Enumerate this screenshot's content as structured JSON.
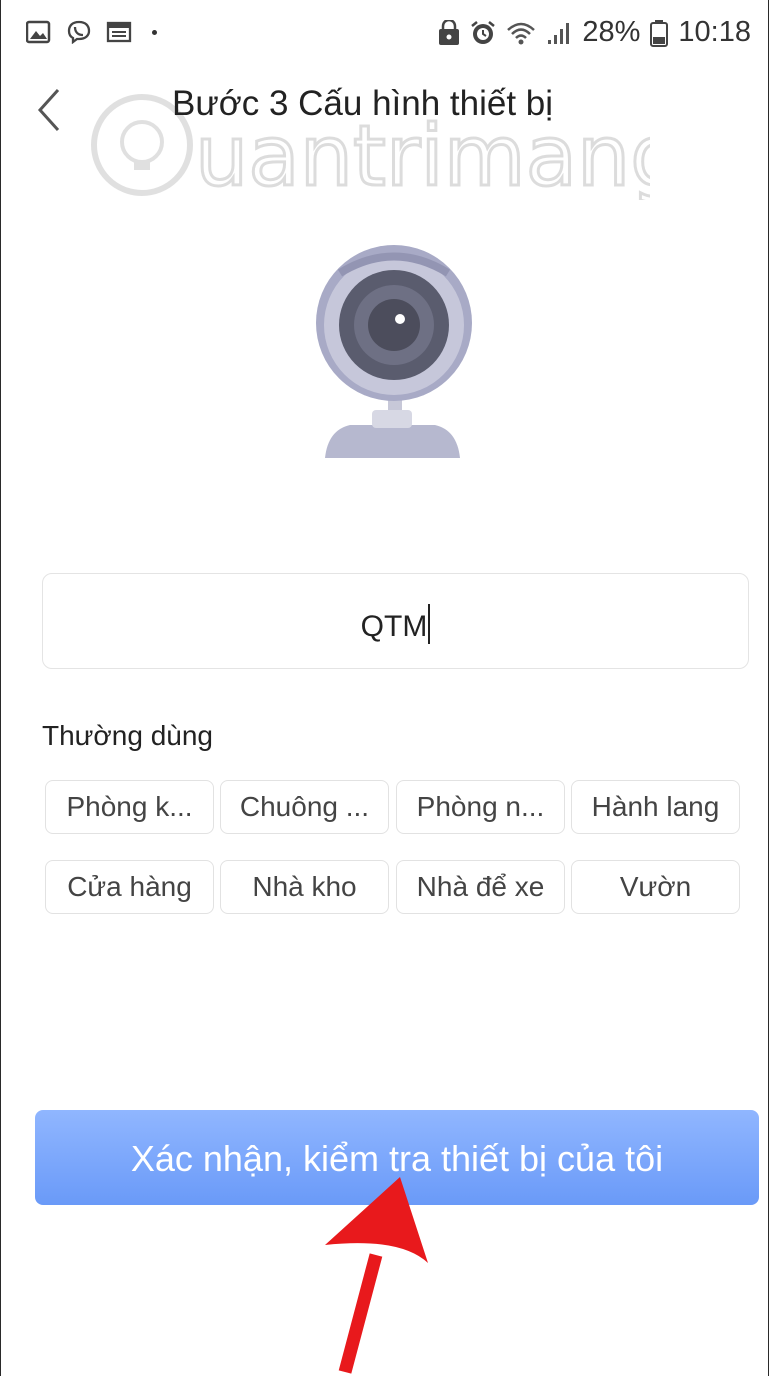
{
  "status_bar": {
    "battery_percent": "28%",
    "time": "10:18",
    "left_icons": [
      "image-icon",
      "viber-icon",
      "calendar-icon"
    ],
    "right_icons": [
      "lock-icon",
      "alarm-icon",
      "wifi-icon",
      "signal-icon",
      "battery-icon"
    ]
  },
  "header": {
    "title": "Bước 3 Cấu hình thiết bị",
    "back_icon": "chevron-left-icon"
  },
  "watermark": {
    "text": "Quantrimang"
  },
  "device_image": {
    "icon": "webcam-icon",
    "accent": "#a5a7c4"
  },
  "name_field": {
    "value": "QTM"
  },
  "common_section": {
    "label": "Thường dùng",
    "chips": [
      "Phòng k...",
      "Chuông ...",
      "Phòng n...",
      "Hành lang",
      "Cửa hàng",
      "Nhà kho",
      "Nhà để xe",
      "Vườn"
    ]
  },
  "confirm_button": {
    "label": "Xác nhận, kiểm tra thiết bị của tôi",
    "color": "#7aa6fb"
  },
  "annotation": {
    "icon": "red-arrow-icon",
    "color": "#e8191c"
  }
}
